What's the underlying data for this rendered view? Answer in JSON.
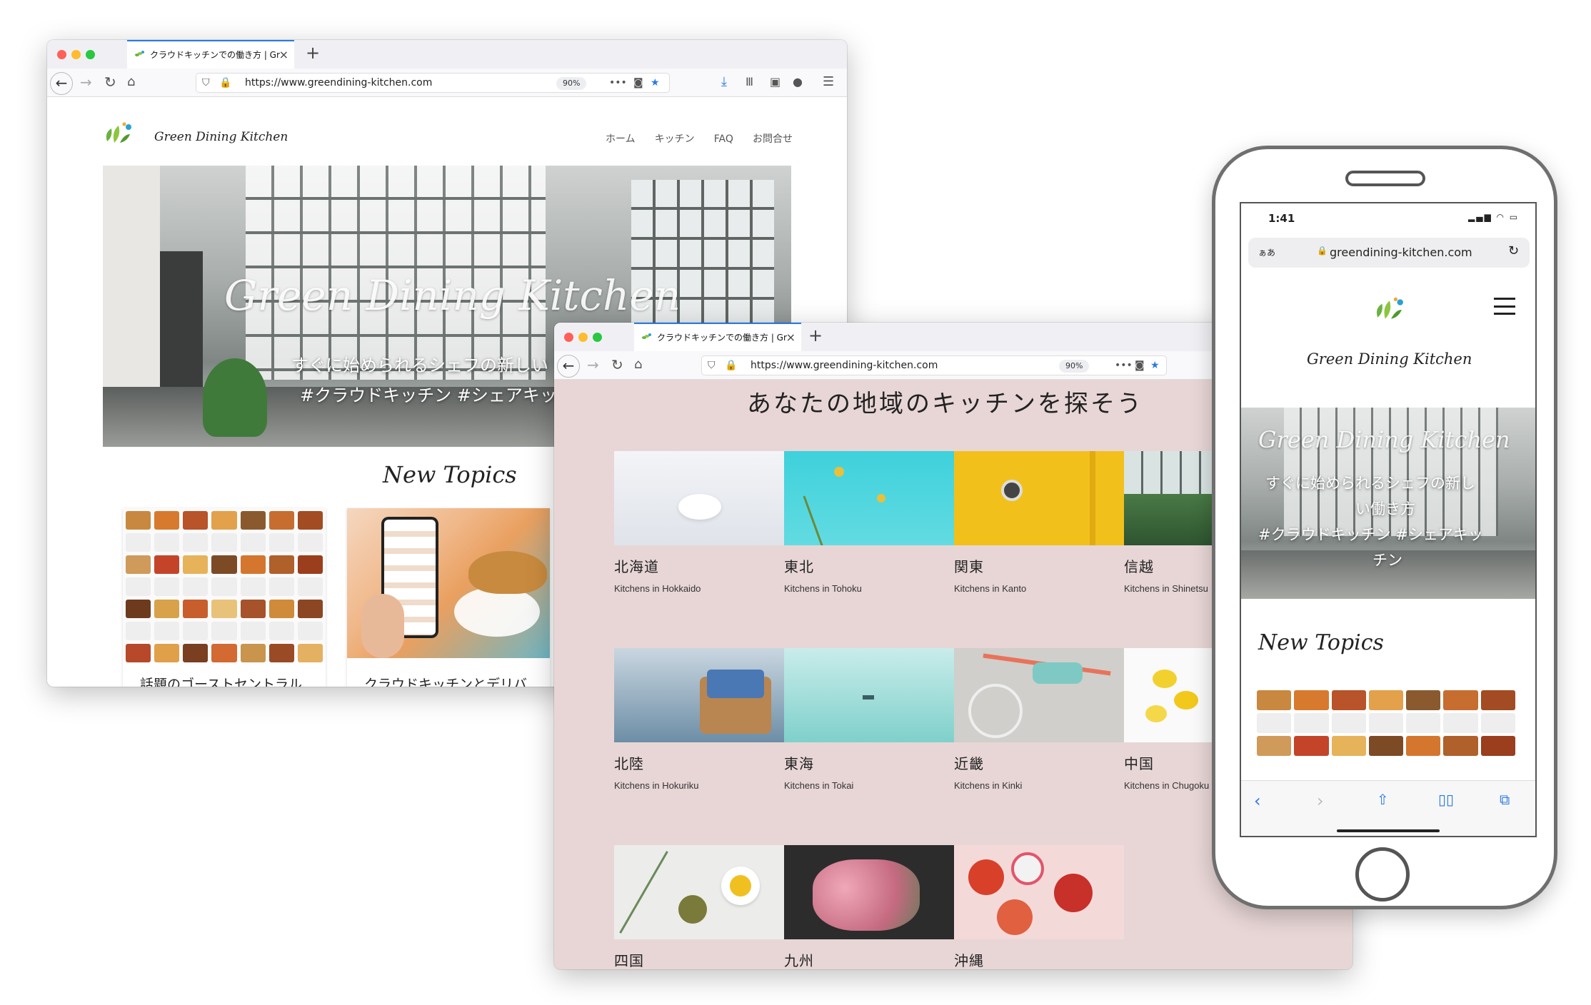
{
  "browser": {
    "tab_title": "クラウドキッチンでの働き方 | Gr",
    "url": "https://www.greendining-kitchen.com",
    "zoom": "90%"
  },
  "site": {
    "logo_text": "Green Dining Kitchen",
    "menu": [
      "ホーム",
      "キッチン",
      "FAQ",
      "お問合せ"
    ],
    "hero_title": "Green Dining Kitchen",
    "hero_sub_1": "すぐに始められるシェフの新しい",
    "hero_sub_2": "#クラウドキッチン #シェアキッ",
    "new_topics": "New Topics",
    "topic_1": "話題のゴーストセントラル",
    "topic_2": "クラウドキッチンとデリバ"
  },
  "regions_page": {
    "heading": "あなたの地域のキッチンを探そう",
    "regions": [
      {
        "jp": "北海道",
        "en": "Kitchens in Hokkaido"
      },
      {
        "jp": "東北",
        "en": "Kitchens in Tohoku"
      },
      {
        "jp": "関東",
        "en": "Kitchens in Kanto"
      },
      {
        "jp": "信越",
        "en": "Kitchens in Shinetsu"
      },
      {
        "jp": "北陸",
        "en": "Kitchens in Hokuriku"
      },
      {
        "jp": "東海",
        "en": "Kitchens in Tokai"
      },
      {
        "jp": "近畿",
        "en": "Kitchens in Kinki"
      },
      {
        "jp": "中国",
        "en": "Kitchens in Chugoku"
      },
      {
        "jp": "四国",
        "en": ""
      },
      {
        "jp": "九州",
        "en": ""
      },
      {
        "jp": "沖縄",
        "en": ""
      }
    ]
  },
  "phone": {
    "time": "1:41",
    "aa": "ぁあ",
    "url": "greendining-kitchen.com",
    "logo_text": "Green Dining Kitchen",
    "hero_title": "Green Dining Kitchen",
    "hero_sub_1": "すぐに始められるシェフの新し",
    "hero_sub_2": "い働き方",
    "hero_sub_3": "#クラウドキッチン #シェアキッ",
    "hero_sub_4": "チン",
    "new_topics": "New Topics"
  },
  "colors": {
    "regions_bg": "#e8d6d6",
    "accent_blue": "#2a7ae2",
    "leaf_green": "#6ab23e"
  }
}
